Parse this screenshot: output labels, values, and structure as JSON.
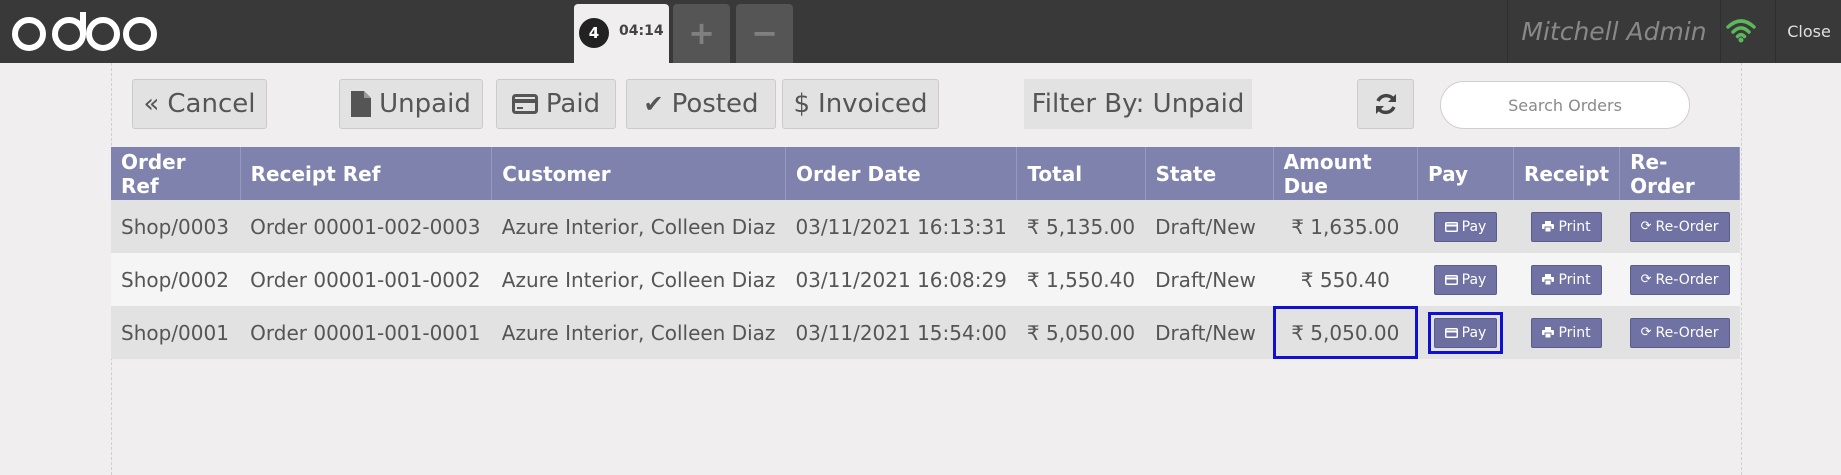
{
  "header": {
    "logo_text": "odoo",
    "order_tab": {
      "number": "4",
      "time": "04:14"
    },
    "add_label": "+",
    "remove_label": "−",
    "user_name": "Mitchell Admin",
    "close_label": "Close",
    "wifi_color": "#5cb85c"
  },
  "toolbar": {
    "cancel_label": "Cancel",
    "unpaid_label": "Unpaid",
    "paid_label": "Paid",
    "posted_label": "Posted",
    "invoiced_label": "Invoiced",
    "filter_label": "Filter By: Unpaid",
    "search_placeholder": "Search Orders"
  },
  "table": {
    "columns": [
      "Order Ref",
      "Receipt Ref",
      "Customer",
      "Order Date",
      "Total",
      "State",
      "Amount Due",
      "Pay",
      "Receipt",
      "Re-Order"
    ],
    "rows": [
      {
        "order_ref": "Shop/0003",
        "receipt_ref": "Order 00001-002-0003",
        "customer": "Azure Interior, Colleen Diaz",
        "order_date": "03/11/2021 16:13:31",
        "total": "₹ 5,135.00",
        "state": "Draft/New",
        "amount_due": "₹ 1,635.00",
        "pay": "Pay",
        "receipt": "Print",
        "reorder": "Re-Order"
      },
      {
        "order_ref": "Shop/0002",
        "receipt_ref": "Order 00001-001-0002",
        "customer": "Azure Interior, Colleen Diaz",
        "order_date": "03/11/2021 16:08:29",
        "total": "₹ 1,550.40",
        "state": "Draft/New",
        "amount_due": "₹ 550.40",
        "pay": "Pay",
        "receipt": "Print",
        "reorder": "Re-Order"
      },
      {
        "order_ref": "Shop/0001",
        "receipt_ref": "Order 00001-001-0001",
        "customer": "Azure Interior, Colleen Diaz",
        "order_date": "03/11/2021 15:54:00",
        "total": "₹ 5,050.00",
        "state": "Draft/New",
        "amount_due": "₹ 5,050.00",
        "pay": "Pay",
        "receipt": "Print",
        "reorder": "Re-Order"
      }
    ]
  },
  "colors": {
    "topbar": "#393939",
    "table_header": "#7f82ac",
    "action_button": "#6f72a3",
    "highlight": "#1010d0"
  }
}
